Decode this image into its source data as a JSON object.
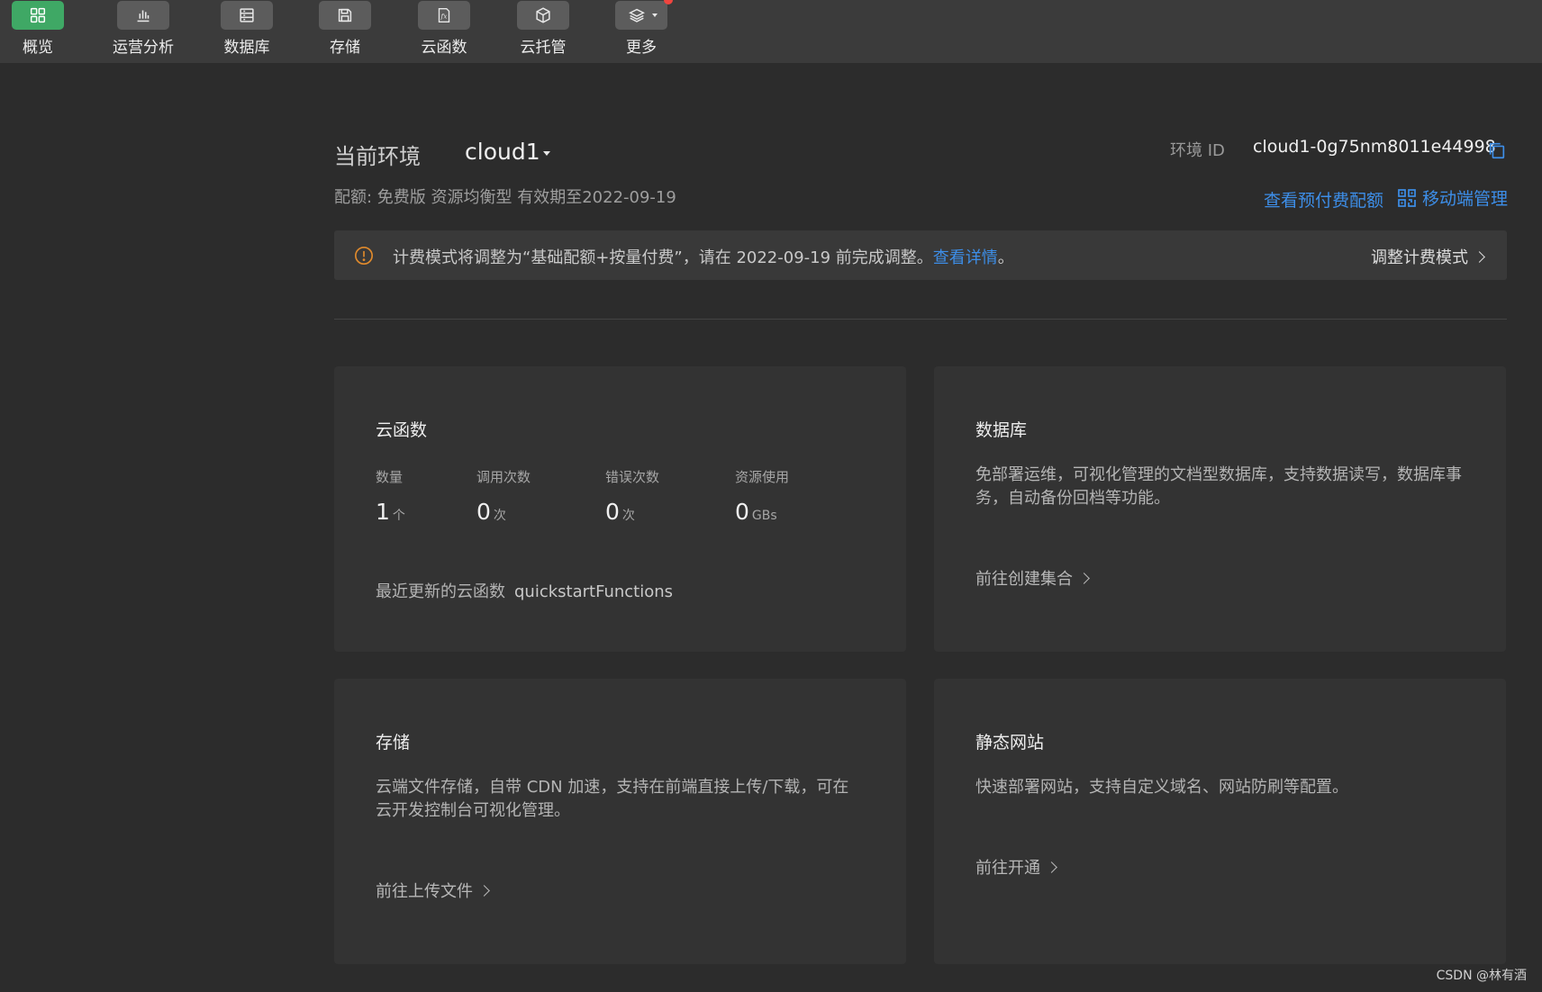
{
  "toolbar": {
    "items": [
      {
        "label": "概览",
        "icon": "overview-grid-icon",
        "active": true
      },
      {
        "label": "运营分析",
        "icon": "bar-chart-icon"
      },
      {
        "label": "数据库",
        "icon": "database-icon"
      },
      {
        "label": "存储",
        "icon": "storage-save-icon"
      },
      {
        "label": "云函数",
        "icon": "function-fx-icon"
      },
      {
        "label": "云托管",
        "icon": "cube-icon"
      },
      {
        "label": "更多",
        "icon": "layers-more-icon",
        "badge": true
      }
    ]
  },
  "env": {
    "label": "当前环境",
    "name": "cloud1",
    "id_label": "环境 ID",
    "id_value": "cloud1-0g75nm8011e44998",
    "quota": "配额: 免费版 资源均衡型 有效期至2022-09-19",
    "prepaid_link": "查看预付费配额",
    "mobile_link": "移动端管理"
  },
  "notice": {
    "text": "计费模式将调整为“基础配额+按量付费”，请在 2022-09-19 前完成调整。",
    "link": "查看详情",
    "link_suffix": "。",
    "action": "调整计费模式"
  },
  "functions_card": {
    "title": "云函数",
    "stats": [
      {
        "label": "数量",
        "value": "1",
        "unit": "个"
      },
      {
        "label": "调用次数",
        "value": "0",
        "unit": "次"
      },
      {
        "label": "错误次数",
        "value": "0",
        "unit": "次"
      },
      {
        "label": "资源使用",
        "value": "0",
        "unit": "GBs"
      }
    ],
    "recent_label": "最近更新的云函数",
    "recent_value": "quickstartFunctions"
  },
  "database_card": {
    "title": "数据库",
    "desc": "免部署运维，可视化管理的文档型数据库，支持数据读写，数据库事务，自动备份回档等功能。",
    "link": "前往创建集合"
  },
  "storage_card": {
    "title": "存储",
    "desc": "云端文件存储，自带 CDN 加速，支持在前端直接上传/下载，可在云开发控制台可视化管理。",
    "link": "前往上传文件"
  },
  "website_card": {
    "title": "静态网站",
    "desc": "快速部署网站，支持自定义域名、网站防刷等配置。",
    "link": "前往开通"
  },
  "colors": {
    "accent": "#3d8ee8",
    "active_green": "#3fa865",
    "badge_red": "#f0453f",
    "warning": "#e08a2c"
  },
  "watermark": "CSDN @林有酒"
}
